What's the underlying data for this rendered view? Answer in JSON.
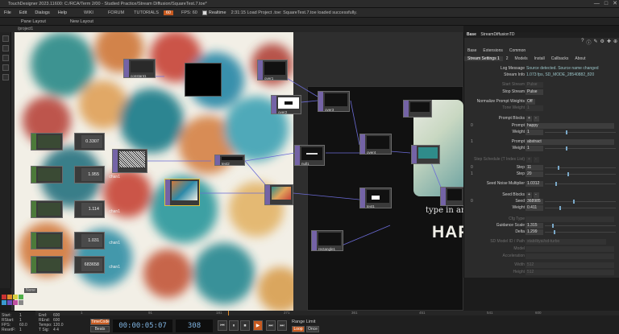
{
  "window": {
    "title": "TouchDesigner 2023.11600: C:/RCA/Term 2/00 - Studied Practice/Stream Diffusion/SquareTest.7.toe*",
    "controls": [
      "—",
      "□",
      "✕"
    ]
  },
  "menubar": {
    "items": [
      "File",
      "Edit",
      "Dialogs",
      "Help"
    ],
    "buttons": [
      "WIKI",
      "FORUM",
      "TUTORIALS"
    ],
    "fps_value": "60",
    "fps_label": "FPS: 60",
    "realtime_label": "Realtime",
    "status_message": "2:31:15 Load Project .toe: SquareTest.7.toe loaded successfully."
  },
  "panebar": {
    "pane_layout": "Pane Layout",
    "new_layout": "New Layout",
    "path": "/project1"
  },
  "network": {
    "nodes": [
      {
        "label": "constant1"
      },
      {
        "label": "over1"
      },
      {
        "label": "over2"
      },
      {
        "label": "over3"
      },
      {
        "label": "over4"
      },
      {
        "label": "null1"
      },
      {
        "label": "text2"
      },
      {
        "label": "text1"
      },
      {
        "label": "rectangle1"
      },
      {
        "label": "StreamDiffusionTD"
      }
    ],
    "chop_values": [
      {
        "value": "0.3307",
        "label": "chan1"
      },
      {
        "value": "1.955",
        "label": "chan1"
      },
      {
        "value": "1.114",
        "label": "chan1"
      },
      {
        "value": "1.031",
        "label": "chan1"
      },
      {
        "value": "683658",
        "label": "chan1"
      }
    ],
    "preview_text_line": "type in an",
    "preview_big_text": "HAP"
  },
  "panel": {
    "node_type": "Base",
    "node_name": "StreamDiffusionTD",
    "page_tabs": [
      "Base",
      "Extensions",
      "Common"
    ],
    "sub_tabs": [
      "Stream Settings 1",
      "2",
      "Models",
      "Install",
      "Callbacks",
      "About"
    ],
    "params": {
      "log_message": {
        "label": "Log Message",
        "value": "Source detected. Source name changed"
      },
      "stream_info": {
        "label": "Stream Info",
        "value": "1.073 fps, SD_MODE_28540882_820"
      },
      "start_stream": {
        "label": "Start Stream",
        "value": "Pulse"
      },
      "stop_stream": {
        "label": "Stop Stream",
        "value": "Pulse"
      },
      "normalize_prompt_weights": {
        "label": "Normalize Prompt Weights",
        "value": "Off"
      },
      "tone_weight": {
        "label": "Tone Weight",
        "value": "1"
      },
      "prompt_blocks": {
        "label": "Prompt Blocks",
        "plus": "+",
        "minus": "-"
      },
      "prompt0": {
        "index": "0",
        "label": "Prompt",
        "value": "happy",
        "weight_label": "Weight",
        "weight": "1"
      },
      "prompt1": {
        "index": "1",
        "label": "Prompt",
        "value": "abstract",
        "weight_label": "Weight",
        "weight": "1"
      },
      "step_schedule": {
        "label": "Step Schedule (T Index List)",
        "plus": "+",
        "minus": "-"
      },
      "step0": {
        "index": "0",
        "label": "Step",
        "value": "11"
      },
      "step1": {
        "index": "1",
        "label": "Step",
        "value": "20"
      },
      "seed_noise_multiplier": {
        "label": "Seed Noise Multiplier",
        "value": "1.0312"
      },
      "seed_blocks": {
        "label": "Seed Blocks",
        "plus": "+",
        "minus": "-"
      },
      "seed0": {
        "index": "0",
        "label": "Seed",
        "value": "368985",
        "weight_label": "Weight",
        "weight": "0.411"
      },
      "cfg_type": {
        "label": "Cfg Type",
        "value": ""
      },
      "guidance_scale": {
        "label": "Guidance Scale",
        "value": "1.315"
      },
      "delta": {
        "label": "Delta",
        "value": "1.299"
      },
      "sd_model_id": {
        "label": "SD Model ID / Path",
        "value": "stabilityai/sd-turbo"
      },
      "model_tag": {
        "label": "Model",
        "value": ""
      },
      "acceleration": {
        "label": "Acceleration",
        "value": ""
      },
      "width": {
        "label": "Width",
        "value": "512"
      },
      "height": {
        "label": "Height",
        "value": "512"
      }
    }
  },
  "bottom": {
    "stats": {
      "start_label": "Start:",
      "start_value": "1",
      "end_label": "End:",
      "end_value": "600",
      "rstart_label": "RStart:",
      "rstart_value": "1",
      "rend_label": "REnd:",
      "rend_value": "600",
      "fps_label": "FPS:",
      "fps_value": "60.0",
      "tempo_label": "Tempo:",
      "tempo_value": "120.0",
      "resetf_label": "ResetF:",
      "resetf_value": "1",
      "tsig_label": "T Sig:",
      "tsig_value": "4 4"
    },
    "timecode_label": "TimeCode",
    "beats_label": "Beats",
    "timecode": "00:00:05:07",
    "frame": "308",
    "range_limit": "Range Limit",
    "loop_label": "Loop",
    "once_label": "Once",
    "transport": [
      "⏮",
      "⏸",
      "⏹",
      "▶",
      "⏭",
      "⏭"
    ],
    "ruler_ticks": [
      "1",
      "91",
      "181",
      "271",
      "361",
      "451",
      "541",
      "600"
    ],
    "palette_label": "None"
  }
}
